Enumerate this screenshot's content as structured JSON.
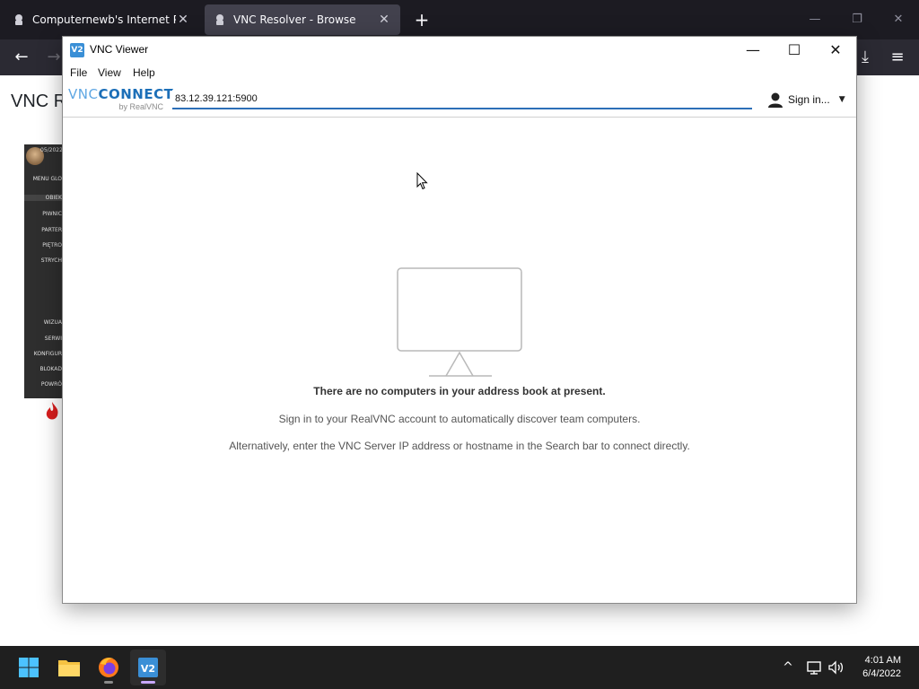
{
  "browser": {
    "tabs": [
      {
        "label": "Computernewb's Internet Pub",
        "active": false
      },
      {
        "label": "VNC Resolver - Browse",
        "active": true
      }
    ],
    "new_tab_symbol": "+",
    "window_controls": {
      "minimize": "—",
      "restore": "❐",
      "close": "✕"
    },
    "nav": {
      "back": "←",
      "forward": "→",
      "downloads": "⤓",
      "menu": "≡"
    }
  },
  "page": {
    "title_partial": "VNC R",
    "remote_thumbnail": {
      "date": "05/2022",
      "items": [
        "MENU GLO",
        "OBIEK",
        "PIWNIC",
        "PARTER",
        "PIĘTRO",
        "STRYCH",
        "WIZUA",
        "SERWI",
        "KONFIGUR",
        "BLOKAD",
        "POWRÓ"
      ]
    }
  },
  "vnc": {
    "window_title": "VNC Viewer",
    "window_controls": {
      "minimize": "—",
      "maximize": "☐",
      "close": "✕"
    },
    "menu": [
      "File",
      "View",
      "Help"
    ],
    "brand": {
      "vnc": "VNC",
      "connect": "CONNECT",
      "sub": "by RealVNC"
    },
    "search": {
      "value": "83.12.39.121:5900"
    },
    "signin": {
      "label": "Sign in...",
      "caret": "▼"
    },
    "empty": {
      "heading": "There are no computers in your address book at present.",
      "line1": "Sign in to your RealVNC account to automatically discover team computers.",
      "line2": "Alternatively, enter the VNC Server IP address or hostname in the Search bar to connect directly."
    }
  },
  "taskbar": {
    "apps": [
      "start",
      "file-explorer",
      "firefox",
      "vnc-viewer"
    ],
    "vnc_icon_label": "V2",
    "tray": {
      "chevron": "^"
    },
    "clock": {
      "time": "4:01 AM",
      "date": "6/4/2022"
    }
  },
  "colors": {
    "accent": "#2c6fb7",
    "tab_bg": "#1c1b22",
    "toolbar_bg": "#2b2a33",
    "taskbar_bg": "#1f1f1f"
  }
}
